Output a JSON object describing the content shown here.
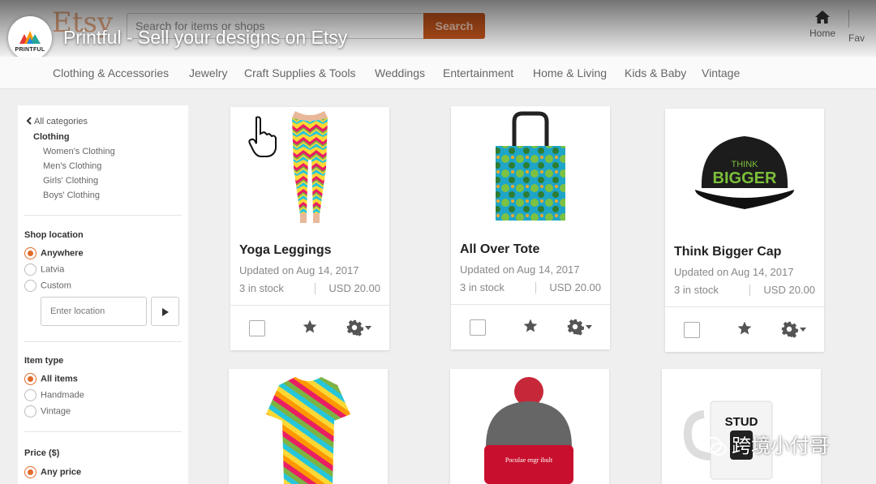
{
  "header": {
    "logo": "Etsy",
    "search_placeholder": "Search for items or shops",
    "search_button": "Search",
    "home_label": "Home",
    "favorites_label": "Fav"
  },
  "video": {
    "channel": "PRINTFUL",
    "title": "Printful - Sell your designs on Etsy"
  },
  "categories": [
    "Clothing & Accessories",
    "Jewelry",
    "Craft Supplies & Tools",
    "Weddings",
    "Entertainment",
    "Home & Living",
    "Kids & Baby",
    "Vintage"
  ],
  "sidebar": {
    "back_label": "All categories",
    "current_category": "Clothing",
    "subcategories": [
      "Women's Clothing",
      "Men's Clothing",
      "Girls' Clothing",
      "Boys' Clothing"
    ],
    "shop_location": {
      "heading": "Shop location",
      "options": [
        "Anywhere",
        "Latvia",
        "Custom"
      ],
      "selected": "Anywhere",
      "input_placeholder": "Enter location"
    },
    "item_type": {
      "heading": "Item type",
      "options": [
        "All items",
        "Handmade",
        "Vintage"
      ],
      "selected": "All items"
    },
    "price": {
      "heading": "Price ($)",
      "options": [
        "Any price"
      ],
      "selected": "Any price"
    }
  },
  "products": [
    {
      "title": "Yoga Leggings",
      "updated": "Updated on Aug 14, 2017",
      "stock": "3 in stock",
      "price": "USD 20.00"
    },
    {
      "title": "All Over Tote",
      "updated": "Updated on Aug 14, 2017",
      "stock": "3 in stock",
      "price": "USD 20.00"
    },
    {
      "title": "Think Bigger Cap",
      "updated": "Updated on Aug 14, 2017",
      "stock": "3 in stock",
      "price": "USD 20.00"
    }
  ],
  "product_images": {
    "cap_text_line1": "THINK",
    "cap_text_line2": "BIGGER",
    "beanie_text": "Poculae engr ibult",
    "mug_text": "STUD"
  },
  "watermark": "跨境小付哥",
  "colors": {
    "etsy_orange": "#d5641c",
    "search_button": "#c9561c",
    "radio_selected": "#e06b2a"
  }
}
